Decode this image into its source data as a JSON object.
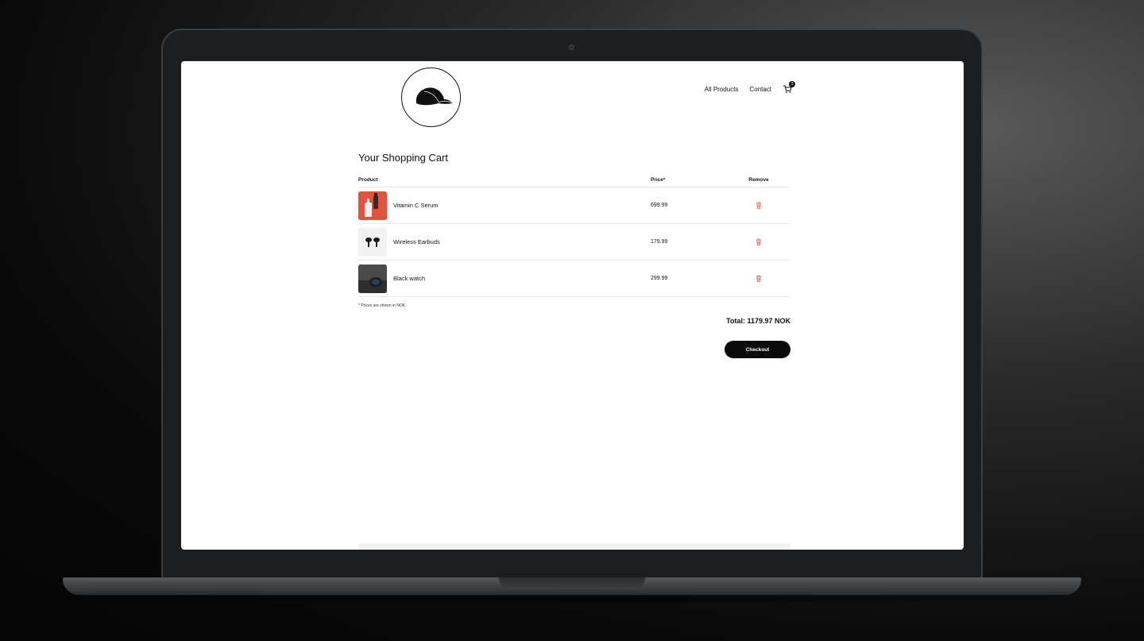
{
  "header": {
    "nav": {
      "all_products": "All Products",
      "contact": "Contact"
    },
    "cart_count": "3"
  },
  "page": {
    "title": "Your Shopping Cart"
  },
  "cart": {
    "columns": {
      "product": "Product",
      "price": "Price*",
      "remove": "Remove"
    },
    "items": [
      {
        "name": "Vitamin C Serum",
        "price": "699.99",
        "thumb": "vitamin-c-serum"
      },
      {
        "name": "Wireless Earbuds",
        "price": "179.99",
        "thumb": "wireless-earbuds"
      },
      {
        "name": "Black watch",
        "price": "299.99",
        "thumb": "black-watch"
      }
    ],
    "note": "* Prices are shown in NOK.",
    "total": "Total: 1179.97 NOK",
    "checkout_label": "Checkout"
  },
  "colors": {
    "accent": "#0b0b0b",
    "remove_icon": "#e05a4f"
  }
}
